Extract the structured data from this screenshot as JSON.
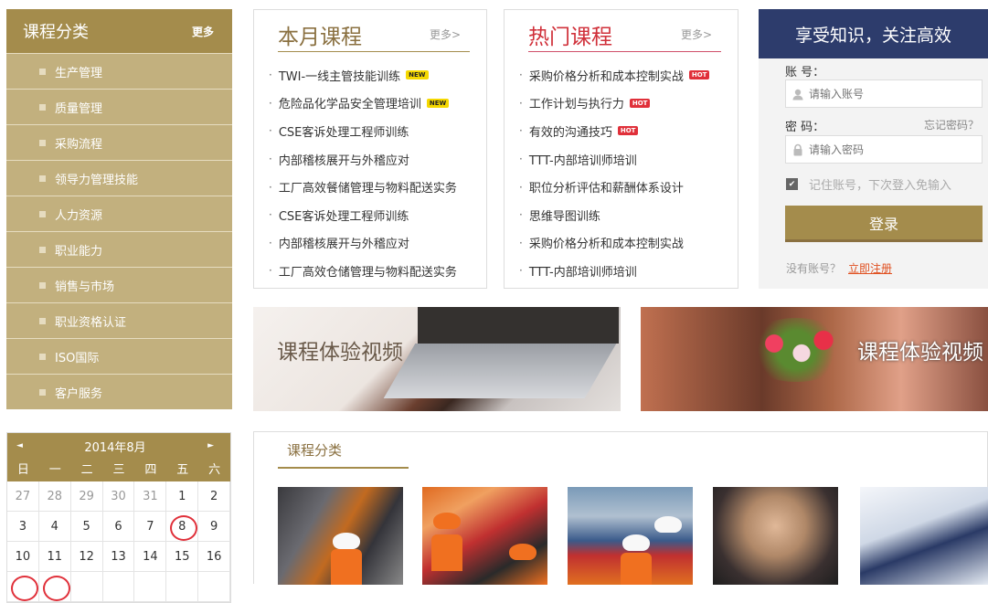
{
  "sidebar": {
    "title": "课程分类",
    "more": "更多",
    "items": [
      "生产管理",
      "质量管理",
      "采购流程",
      "领导力管理技能",
      "人力资源",
      "职业能力",
      "销售与市场",
      "职业资格认证",
      "ISO国际",
      "客户服务"
    ]
  },
  "calendar": {
    "title": "2014年8月",
    "prev": "◄",
    "next": "►",
    "weekdays": [
      "日",
      "一",
      "二",
      "三",
      "四",
      "五",
      "六"
    ],
    "weeks": [
      [
        "27",
        "28",
        "29",
        "30",
        "31",
        "1",
        "2"
      ],
      [
        "3",
        "4",
        "5",
        "6",
        "7",
        "8",
        "9"
      ],
      [
        "10",
        "11",
        "12",
        "13",
        "14",
        "15",
        "16"
      ]
    ]
  },
  "monthly": {
    "title": "本月课程",
    "more": "更多>",
    "items": [
      {
        "text": "TWI-一线主管技能训练",
        "tag": "NEW"
      },
      {
        "text": "危险品化学品安全管理培训",
        "tag": "NEW"
      },
      {
        "text": "CSE客诉处理工程师训练",
        "tag": ""
      },
      {
        "text": "内部稽核展开与外稽应对",
        "tag": ""
      },
      {
        "text": "工厂高效餐储管理与物料配送实务",
        "tag": ""
      },
      {
        "text": "CSE客诉处理工程师训练",
        "tag": ""
      },
      {
        "text": "内部稽核展开与外稽应对",
        "tag": ""
      },
      {
        "text": "工厂高效仓储管理与物料配送实务",
        "tag": ""
      }
    ]
  },
  "hot": {
    "title": "热门课程",
    "more": "更多>",
    "items": [
      {
        "text": "采购价格分析和成本控制实战",
        "tag": "HOT"
      },
      {
        "text": "工作计划与执行力",
        "tag": "HOT"
      },
      {
        "text": "有效的沟通技巧",
        "tag": "HOT"
      },
      {
        "text": "TTT-内部培训师培训",
        "tag": ""
      },
      {
        "text": "职位分析评估和薪酬体系设计",
        "tag": ""
      },
      {
        "text": "思维导图训练",
        "tag": ""
      },
      {
        "text": "采购价格分析和成本控制实战",
        "tag": ""
      },
      {
        "text": "TTT-内部培训师培训",
        "tag": ""
      }
    ]
  },
  "login": {
    "header": "享受知识，关注高效",
    "account_label": "账 号：",
    "account_placeholder": "请输入账号",
    "password_label": "密 码：",
    "forgot": "忘记密码？",
    "password_placeholder": "请输入密码",
    "remember": "记住账号，下次登入免输入",
    "submit": "登录",
    "no_account": "没有账号？",
    "register": "立即注册"
  },
  "banners": [
    "课程体验视频",
    "课程体验视频"
  ],
  "categories": {
    "title": "课程分类"
  },
  "colors": {
    "brand": "#a48c4c",
    "sidebar_bg": "#c2b07e",
    "login_header": "#2d3c6c",
    "hot_red": "#d0303a"
  }
}
